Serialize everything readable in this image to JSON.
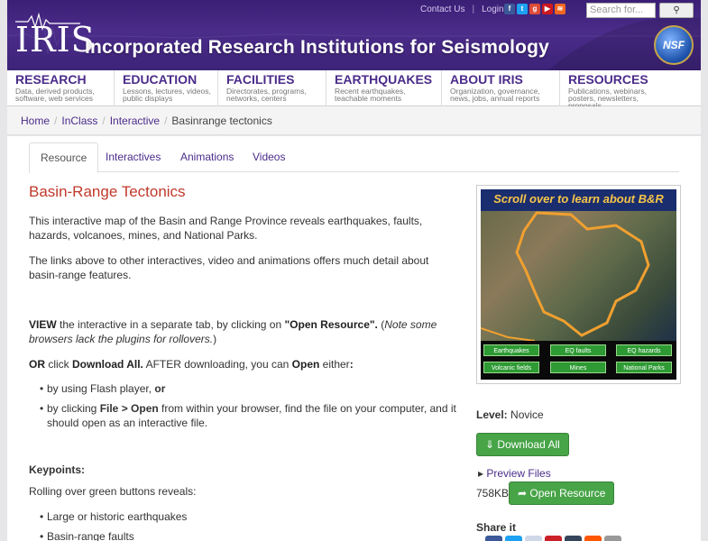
{
  "header": {
    "logo_text": "IRIS",
    "site_title": "Incorporated Research Institutions for Seismology",
    "contact_label": "Contact Us",
    "login_label": "Login",
    "search_placeholder": "Search for...",
    "nsf_label": "NSF"
  },
  "nav": [
    {
      "title": "RESEARCH",
      "desc": "Data, derived products, software, web services"
    },
    {
      "title": "EDUCATION",
      "desc": "Lessons, lectures, videos, public displays"
    },
    {
      "title": "FACILITIES",
      "desc": "Directorates, programs, networks, centers"
    },
    {
      "title": "EARTHQUAKES",
      "desc": "Recent earthquakes, teachable moments"
    },
    {
      "title": "ABOUT IRIS",
      "desc": "Organization, governance, news, jobs, annual reports"
    },
    {
      "title": "RESOURCES",
      "desc": "Publications, webinars, posters, newsletters, proposals"
    }
  ],
  "breadcrumb": {
    "home": "Home",
    "inclass": "InClass",
    "interactive": "Interactive",
    "current": "Basinrange tectonics"
  },
  "tabs": [
    "Resource",
    "Interactives",
    "Animations",
    "Videos"
  ],
  "main": {
    "title": "Basin-Range Tectonics",
    "p1": "This interactive map of the Basin and Range Province reveals earthquakes, faults, hazards, volcanoes, mines, and National Parks.",
    "p2": "The links above to other interactives, video and animations offers much detail about basin-range features.",
    "view_bold": "VIEW",
    "view_text": " the interactive in a separate tab, by clicking on ",
    "view_open": "\"Open Resource\".",
    "view_note_open": " (",
    "view_note": "Note some browsers lack the plugins for rollovers.",
    "view_note_close": ")",
    "or_bold": "OR",
    "or_text1": " click ",
    "or_download": "Download All.",
    "or_text2": "  AFTER downloading, you can ",
    "or_open": "Open",
    "or_text3": " either",
    "or_colon": ":",
    "bullet1_text": "by using Flash player, ",
    "bullet1_bold": "or",
    "bullet2_text1": "by clicking ",
    "bullet2_bold": "File > Open",
    "bullet2_text2": " from within your browser, find the file on your computer, and it should open as an interactive file.",
    "keypoints": "Keypoints:",
    "rolling": "Rolling over green buttons reveals:",
    "kp1": "Large or historic earthquakes",
    "kp2": "Basin-range faults"
  },
  "thumb": {
    "banner": "Scroll over to learn about B&R",
    "buttons": [
      "Earthquakes",
      "EQ faults",
      "EQ hazards",
      "Volcanic fields",
      "Mines",
      "National Parks"
    ]
  },
  "side": {
    "level_label": "Level:",
    "level_value": "Novice",
    "download_label": "Download All",
    "preview_label": "Preview Files",
    "size": "758KB",
    "open_label": "Open Resource",
    "share_label": "Share it"
  },
  "colors": {
    "brand_purple": "#4b2c8a",
    "title_red": "#c0392b",
    "button_green": "#47a447"
  }
}
